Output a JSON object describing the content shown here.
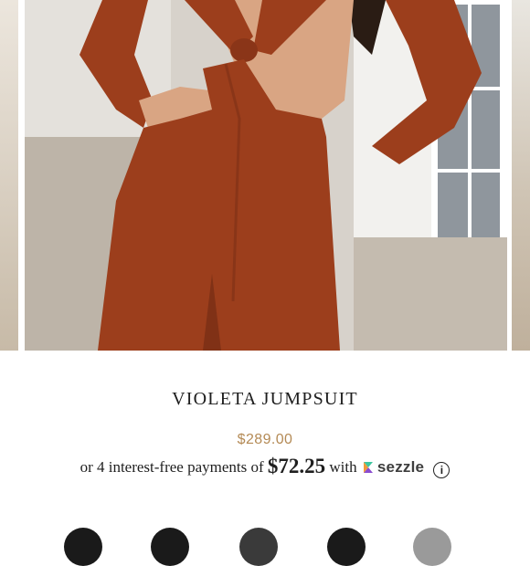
{
  "product": {
    "title": "VIOLETA JUMPSUIT",
    "price": "$289.00"
  },
  "installments": {
    "prefix": "or 4 interest-free payments of",
    "amount": "$72.25",
    "suffix": "with",
    "provider": "sezzle",
    "info_glyph": "i"
  },
  "gallery": {
    "main_image_alt": "Model wearing rust long-sleeve cut-out jumpsuit",
    "icons": [
      "sezzle-logo-icon",
      "info-icon"
    ]
  },
  "colors": {
    "accent_price": "#b48a55",
    "garment": "#9c3e1c",
    "swatches": [
      "#1a1a1a",
      "#1a1a1a",
      "#3a3a3a",
      "#1a1a1a",
      "#9a9a9a"
    ]
  }
}
